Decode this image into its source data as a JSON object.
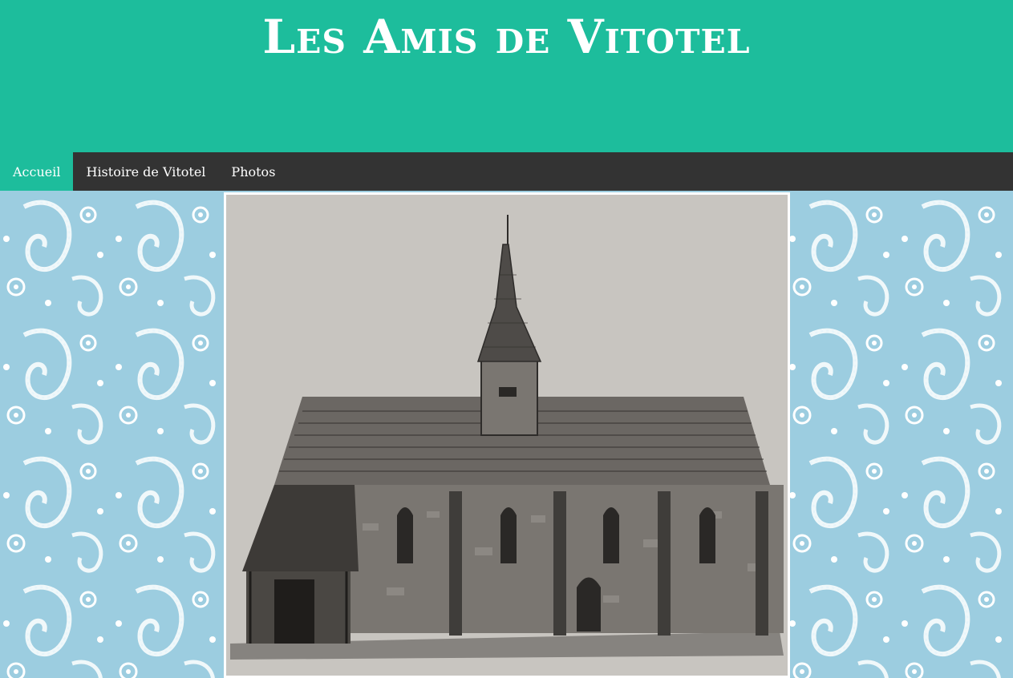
{
  "site": {
    "title": "Les Amis de Vitotel"
  },
  "nav": {
    "items": [
      {
        "label": "Accueil",
        "active": true
      },
      {
        "label": "Histoire de Vitotel",
        "active": false
      },
      {
        "label": "Photos",
        "active": false
      }
    ]
  },
  "colors": {
    "header_bg": "#1dbd9c",
    "nav_bg": "#333333",
    "nav_active_bg": "#1dbd9c",
    "background_pattern": "#9ccde0"
  },
  "content": {
    "background_pattern": "paisley",
    "image_subject": "church-drawing"
  }
}
